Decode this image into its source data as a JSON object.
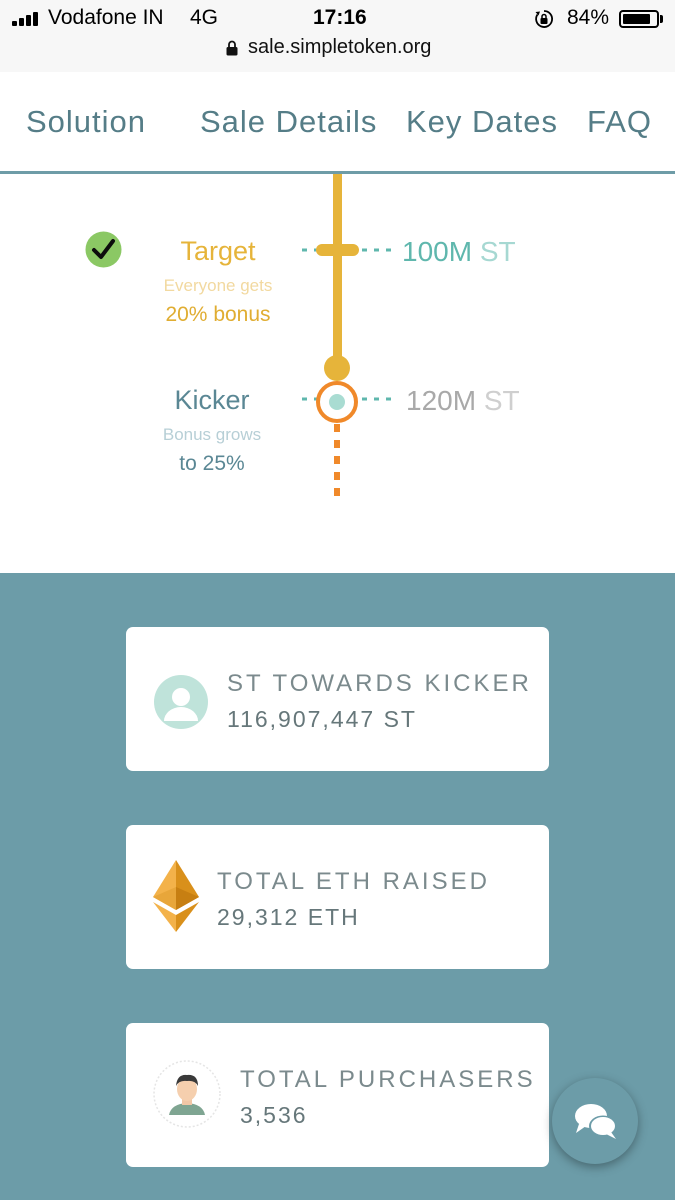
{
  "status_bar": {
    "carrier": "Vodafone IN",
    "network": "4G",
    "time": "17:16",
    "battery_percent": "84%",
    "battery_level": 0.84
  },
  "browser": {
    "url": "sale.simpletoken.org"
  },
  "nav": {
    "items": [
      {
        "label": "Solution"
      },
      {
        "label": "Sale Details"
      },
      {
        "label": "Key Dates"
      },
      {
        "label": "FAQ"
      }
    ]
  },
  "timeline": {
    "target": {
      "label": "Target",
      "description": "Everyone gets",
      "bonus": "20% bonus",
      "amount": "100M",
      "unit": "ST",
      "reached": true
    },
    "kicker": {
      "label": "Kicker",
      "description": "Bonus grows",
      "bonus": "to 25%",
      "amount": "120M",
      "unit": "ST"
    }
  },
  "stats": [
    {
      "title": "ST TOWARDS KICKER",
      "value": "116,907,447 ST",
      "icon": "user-circle-icon"
    },
    {
      "title": "TOTAL ETH RAISED",
      "value": "29,312 ETH",
      "icon": "ethereum-icon"
    },
    {
      "title": "TOTAL PURCHASERS",
      "value": "3,536",
      "icon": "person-avatar-icon"
    }
  ],
  "colors": {
    "accent_teal": "#6c9ca8",
    "gold": "#e6b43a",
    "orange": "#f0892a",
    "mint": "#a9dcd2"
  }
}
